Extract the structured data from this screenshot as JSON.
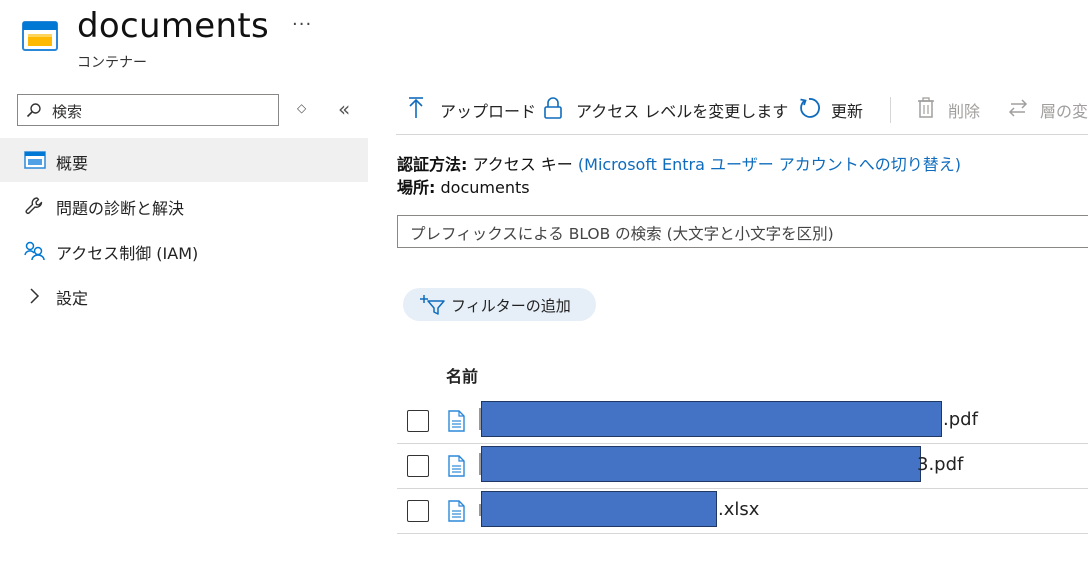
{
  "header": {
    "title": "documents",
    "subtitle": "コンテナー",
    "more_label": "···"
  },
  "sidebar": {
    "search_placeholder": "検索",
    "updown": "◇",
    "collapse": "«",
    "items": [
      {
        "label": "概要",
        "icon": "container-icon",
        "active": true
      },
      {
        "label": "問題の診断と解決",
        "icon": "wrench-icon"
      },
      {
        "label": "アクセス制御 (IAM)",
        "icon": "people-icon"
      },
      {
        "label": "設定",
        "icon": "chevron-right-icon"
      }
    ]
  },
  "toolbar": {
    "upload": "アップロード",
    "change_access": "アクセス レベルを変更します",
    "refresh": "更新",
    "delete": "削除",
    "change_tier": "層の変"
  },
  "info": {
    "auth_label": "認証方法:",
    "auth_value": "アクセス キー",
    "auth_link": "(Microsoft Entra ユーザー アカウントへの切り替え)",
    "location_label": "場所:",
    "location_value": "documents"
  },
  "blob_search": {
    "placeholder": "プレフィックスによる BLOB の検索 (大文字と小文字を区別)"
  },
  "filter": {
    "label": "フィルターの追加"
  },
  "table": {
    "column_name": "名前",
    "rows": [
      {
        "visible_suffix": ".pdf"
      },
      {
        "visible_suffix": "3.pdf"
      },
      {
        "visible_suffix": ".xlsx"
      }
    ]
  },
  "colors": {
    "accent": "#0f6cbd",
    "redaction": "#4472c4",
    "active_nav_bg": "#f0f0f0",
    "filter_pill_bg": "#e6eef7"
  }
}
